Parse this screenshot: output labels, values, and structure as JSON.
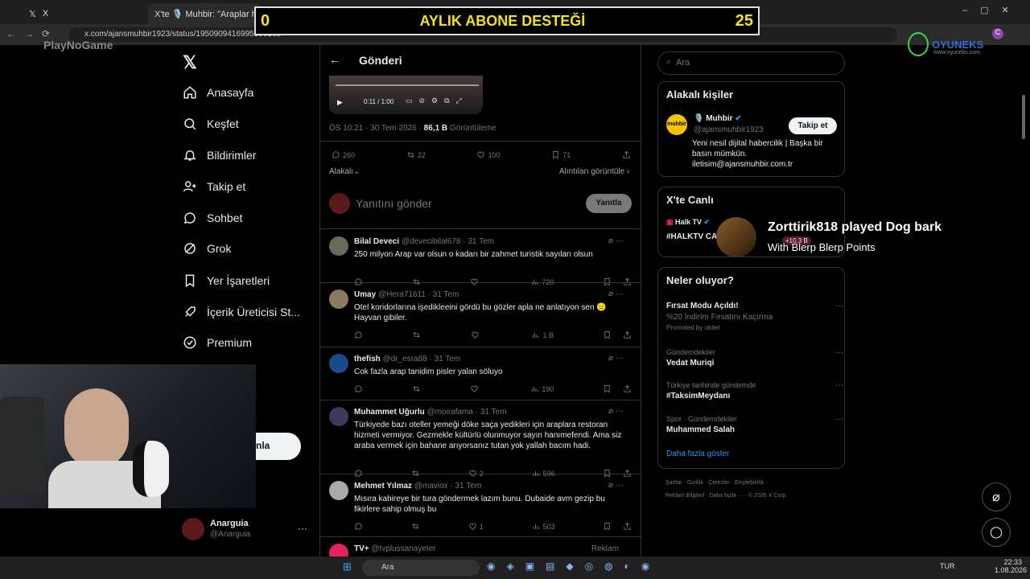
{
  "browser": {
    "tabs": [
      {
        "label": "X"
      },
      {
        "label": "X'te 🎙️ Muhbir: \"Araplar hakk..."
      }
    ],
    "url": "x.com/ajansmuhbir1923/status/1950909416995590168",
    "new_tab": "+"
  },
  "stream_overlay": {
    "left_num": "0",
    "title": "AYLIK ABONE DESTEĞİ",
    "right_num": "25",
    "logo_left": "PlayNoGame",
    "logo_right": "OYUNEKS",
    "logo_right_sub": "www.oyuneks.com"
  },
  "sidebar": {
    "items": [
      {
        "label": "Anasayfa",
        "icon": "home-icon"
      },
      {
        "label": "Keşfet",
        "icon": "search-icon"
      },
      {
        "label": "Bildirimler",
        "icon": "bell-icon"
      },
      {
        "label": "Takip et",
        "icon": "person-plus-icon"
      },
      {
        "label": "Sohbet",
        "icon": "chat-icon"
      },
      {
        "label": "Grok",
        "icon": "grok-icon"
      },
      {
        "label": "Yer İşaretleri",
        "icon": "bookmark-icon"
      },
      {
        "label": "İçerik Üreticisi St...",
        "icon": "rocket-icon"
      },
      {
        "label": "Premium",
        "icon": "check-badge-icon"
      }
    ],
    "post_btn": "nla",
    "account_name": "Anarguia",
    "account_handle": "@Anarguia",
    "more": "···"
  },
  "header": {
    "title": "Gönderi",
    "back": "←"
  },
  "video": {
    "time": "0:11 / 1:00"
  },
  "post_meta": {
    "time": "ÖS 10:21 · 30 Tem 2026",
    "views": "86,1 B",
    "views_label": "Görüntüleme"
  },
  "post_stats": {
    "replies": "260",
    "retweets": "22",
    "likes": "100",
    "bookmarks": "71"
  },
  "sort": {
    "left": "Alakalı",
    "right": "Alıntıları görüntüle ›"
  },
  "reply_box": {
    "placeholder": "Yanıtını gönder",
    "button": "Yanıtla"
  },
  "replies": [
    {
      "name": "Bilal Deveci",
      "handle": "@devecibilal678 · 31 Tem",
      "text": "250 milyon Arap var olsun o kadarı bir zahmet turistik sayıları olsun",
      "likes": "",
      "views": "720"
    },
    {
      "name": "Umay",
      "handle": "@Hera71611 · 31 Tem",
      "text": "Otel koridorlarına işedikleeini gördü bu gözler apla ne anlatıyon sen 😑 Hayvan gibiler.",
      "likes": "",
      "views": "1 B"
    },
    {
      "name": "thefish",
      "handle": "@dr_esra88 · 31 Tem",
      "text": "Cok fazla arap tanidim  pisler yalan söluyo",
      "likes": "",
      "views": "190"
    },
    {
      "name": "Muhammet Uğurlu",
      "handle": "@moirafama · 31 Tem",
      "text": "Türkiyede bazı oteller yemeği döke saça yedikleri için araplara restoran hizmeti vermiyor. Gezmekle kültürlü olunmuyor sayın hanımefendi. Ama siz araba vermek için bahane arıyorsanız tutan yok yallah bacım hadi.",
      "likes": "2",
      "views": "596"
    },
    {
      "name": "Mehmet Yılmaz",
      "handle": "@maviox · 31 Tem",
      "text": "Mısıra kahireye bir tura göndermek lazım bunu. Dubaide avm gezip bu fikirlere sahip olmuş bu",
      "likes": "1",
      "views": "503"
    },
    {
      "name": "TV+",
      "handle": "@tvplussanayeter",
      "text": "",
      "likes": "",
      "views": "",
      "ad": "Reklam"
    }
  ],
  "right": {
    "search_placeholder": "Ara",
    "people": {
      "title": "Alakalı kişiler",
      "name": "🎙️ Muhbir",
      "handle": "@ajansmuhbir1923",
      "follow": "Takip et",
      "bio": "Yeni nesil dijital habercilik | Başka bir basın mümkün. iletisim@ajansmuhbir.com.tr"
    },
    "live": {
      "title": "X'te Canlı",
      "channel": "Halk TV",
      "tag": "#HALKTV CA",
      "count": "+10,3 B"
    },
    "whats": {
      "title": "Neler oluyor?",
      "items": [
        {
          "top": "",
          "title": "Fırsat Modu Açıldı!",
          "sub": "%20 İndirim Fırsatını Kaçırma",
          "promo": "Promoted by obilet"
        },
        {
          "top": "Gündemdekiler",
          "title": "Vedat Muriqi",
          "sub": "",
          "promo": ""
        },
        {
          "top": "Türkiye tarihinde gündemde",
          "title": "#TaksimMeydanı",
          "sub": "",
          "promo": ""
        },
        {
          "top": "Spor · Gündemdekiler",
          "title": "Muhammed Salah",
          "sub": "",
          "promo": ""
        }
      ],
      "more": "Daha fazla göster"
    },
    "footer1": "Şartlar  ·  Gizlilik  ·  Çerezler  ·  Erişilebilirlik  ·",
    "footer2": "Reklam Bilgileri  ·  Daha fazla ···  ·  © 2026 X Corp."
  },
  "alert": {
    "title": "Zorttirik818 played Dog bark",
    "sub": "With Blerp Blerp Points"
  },
  "taskbar": {
    "search": "Ara",
    "lang": "TUR",
    "time": "22:33",
    "date": "1.08.2026"
  },
  "colors": {
    "accent": "#1d9bf0",
    "overlay_text": "#f2e21c",
    "logo_green": "#39d353"
  }
}
